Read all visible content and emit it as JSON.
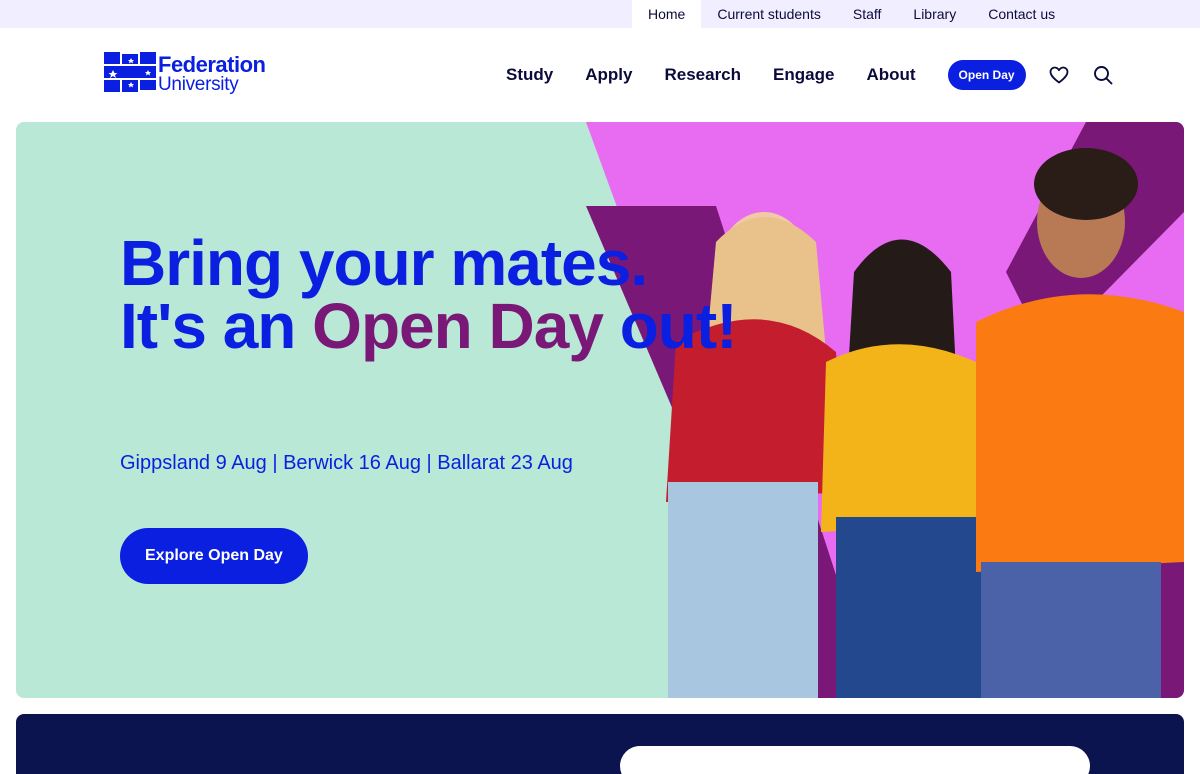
{
  "utility_nav": {
    "items": [
      {
        "label": "Home",
        "active": true
      },
      {
        "label": "Current students"
      },
      {
        "label": "Staff"
      },
      {
        "label": "Library"
      },
      {
        "label": "Contact us"
      }
    ]
  },
  "header": {
    "logo": {
      "line1": "Federation",
      "line2": "University"
    },
    "nav": [
      {
        "label": "Study"
      },
      {
        "label": "Apply"
      },
      {
        "label": "Research"
      },
      {
        "label": "Engage"
      },
      {
        "label": "About"
      }
    ],
    "open_day_button": "Open Day",
    "icons": [
      "heart-icon",
      "search-icon"
    ]
  },
  "hero": {
    "headline_part1": "Bring your mates. It's an ",
    "headline_accent": "Open Day",
    "headline_part2": " out!",
    "dates": "Gippsland 9 Aug | Berwick 16 Aug | Ballarat 23 Aug",
    "cta": "Explore Open Day"
  },
  "colors": {
    "brand_blue": "#0a1fe0",
    "accent_purple": "#7a1878",
    "hero_mint": "#b9e8d6",
    "hero_pink": "#e86cf2",
    "navy": "#0c1450"
  }
}
